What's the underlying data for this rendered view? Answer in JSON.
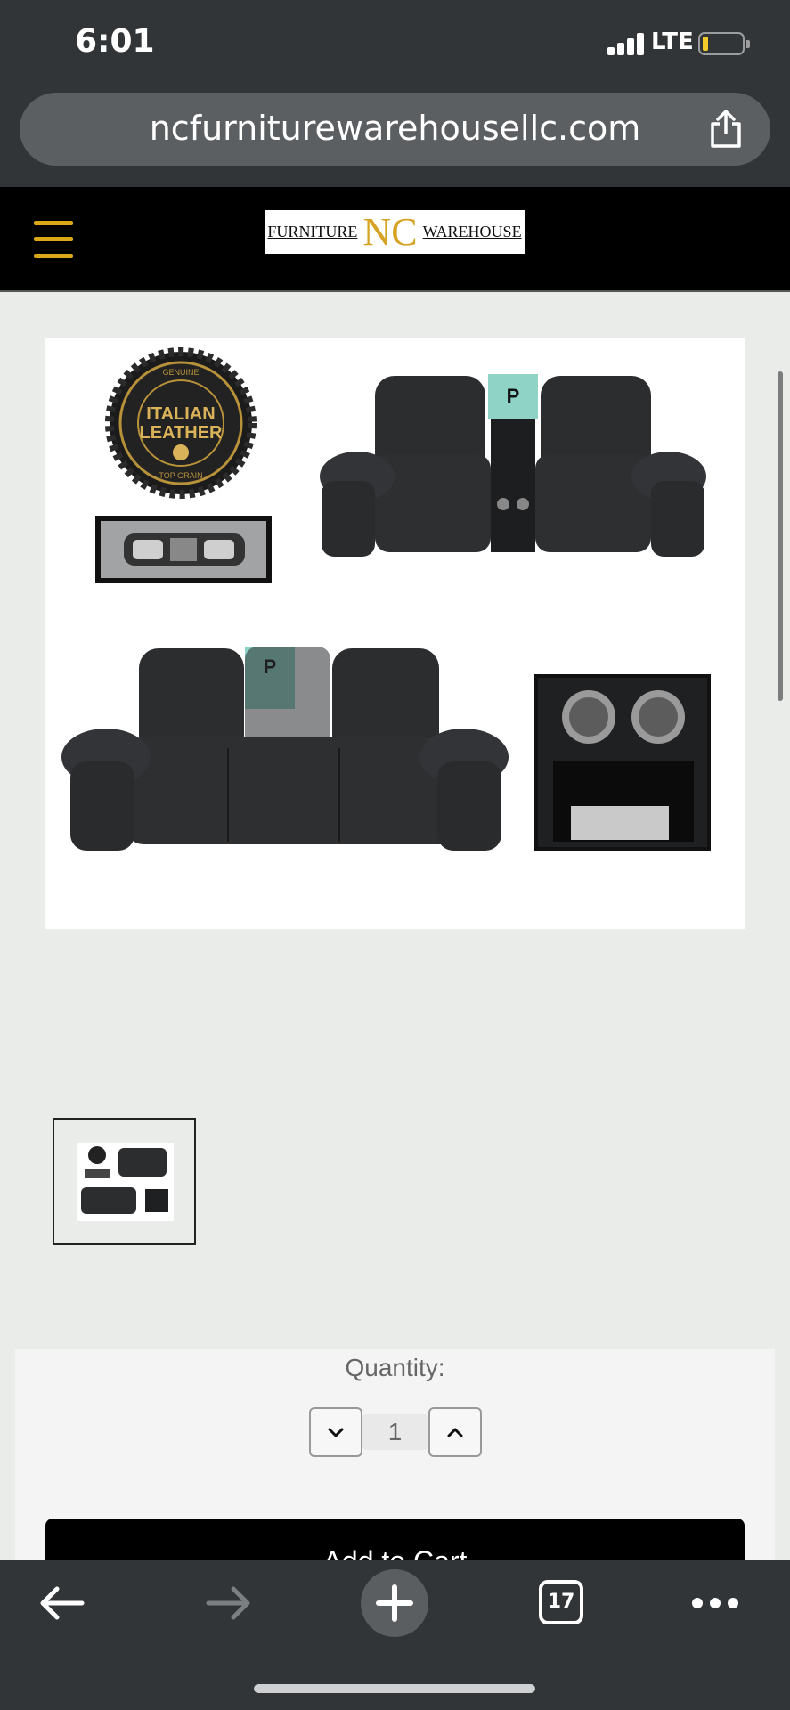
{
  "status_bar": {
    "time": "6:01",
    "network": "LTE"
  },
  "browser": {
    "url": "ncfurniturewarehousellc.com"
  },
  "site": {
    "logo_left": "FURNITURE",
    "logo_mid": "NC",
    "logo_right": "WAREHOUSE",
    "accent_color": "#d9a718"
  },
  "product": {
    "badge_line1": "ITALIAN",
    "badge_line2": "LEATHER",
    "badge_top": "GENUINE",
    "badge_bottom": "TOP GRAIN"
  },
  "cart": {
    "quantity_label": "Quantity:",
    "quantity_value": "1",
    "add_to_cart_label": "Add to Cart"
  },
  "toolbar": {
    "tab_count": "17"
  },
  "icons": [
    "share-icon",
    "hamburger-menu-icon",
    "chevron-down-icon",
    "chevron-up-icon",
    "back-arrow-icon",
    "forward-arrow-icon",
    "plus-icon",
    "tabs-icon",
    "more-icon"
  ]
}
